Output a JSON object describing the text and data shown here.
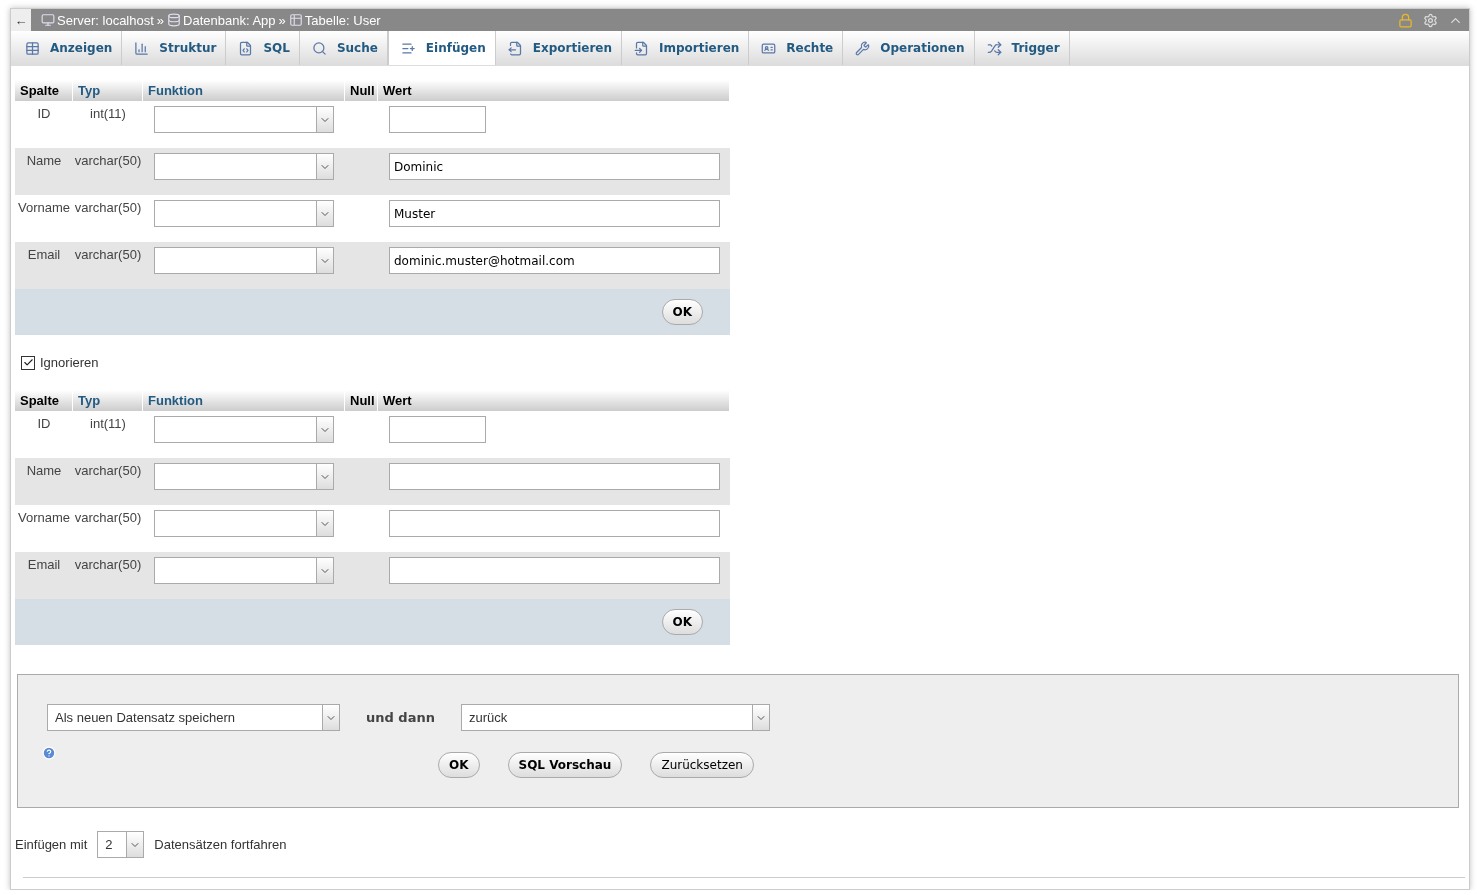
{
  "topbar": {
    "back": "←",
    "breadcrumb": [
      {
        "kind": "server",
        "label": "Server: localhost"
      },
      {
        "kind": "database",
        "label": "Datenbank: App"
      },
      {
        "kind": "table",
        "label": "Tabelle: User"
      }
    ],
    "separator": "»"
  },
  "tabs": [
    {
      "label": "Anzeigen",
      "selected": false
    },
    {
      "label": "Struktur",
      "selected": false
    },
    {
      "label": "SQL",
      "selected": false
    },
    {
      "label": "Suche",
      "selected": false
    },
    {
      "label": "Einfügen",
      "selected": true
    },
    {
      "label": "Exportieren",
      "selected": false
    },
    {
      "label": "Importieren",
      "selected": false
    },
    {
      "label": "Rechte",
      "selected": false
    },
    {
      "label": "Operationen",
      "selected": false
    },
    {
      "label": "Trigger",
      "selected": false
    }
  ],
  "forms": [
    {
      "headers": [
        {
          "label": "Spalte",
          "kind": "text"
        },
        {
          "label": "Typ",
          "kind": "link"
        },
        {
          "label": "Funktion",
          "kind": "link"
        },
        {
          "label": "Null",
          "kind": "text"
        },
        {
          "label": "Wert",
          "kind": "text"
        }
      ],
      "rows": [
        {
          "column": "ID",
          "type": "int(11)",
          "kind": "short"
        },
        {
          "column": "Name",
          "type": "varchar(50)",
          "kind": "long",
          "value": "Dominic"
        },
        {
          "column": "Vorname",
          "type": "varchar(50)",
          "kind": "long",
          "value": "Muster"
        },
        {
          "column": "Email",
          "type": "varchar(50)",
          "kind": "long",
          "value": "dominic.muster@hotmail.com"
        }
      ],
      "ok": "OK",
      "ignore": {
        "label": "Ignorieren",
        "checked": true
      }
    },
    {
      "headers": [
        {
          "label": "Spalte",
          "kind": "text"
        },
        {
          "label": "Typ",
          "kind": "link"
        },
        {
          "label": "Funktion",
          "kind": "link"
        },
        {
          "label": "Null",
          "kind": "text"
        },
        {
          "label": "Wert",
          "kind": "text"
        }
      ],
      "rows": [
        {
          "column": "ID",
          "type": "int(11)",
          "kind": "short"
        },
        {
          "column": "Name",
          "type": "varchar(50)",
          "kind": "long"
        },
        {
          "column": "Vorname",
          "type": "varchar(50)",
          "kind": "long"
        },
        {
          "column": "Email",
          "type": "varchar(50)",
          "kind": "long"
        }
      ],
      "ok": "OK"
    }
  ],
  "actions": {
    "save_mode": "Als neuen Datensatz speichern",
    "and_then": "und dann",
    "after": "zurück",
    "buttons": [
      {
        "label": "OK",
        "kind": "bold"
      },
      {
        "label": "SQL Vorschau",
        "kind": "bold"
      },
      {
        "label": "Zurücksetzen",
        "kind": "plain"
      }
    ]
  },
  "continue": {
    "before": "Einfügen mit",
    "count": "2",
    "after": "Datensätzen fortfahren"
  }
}
